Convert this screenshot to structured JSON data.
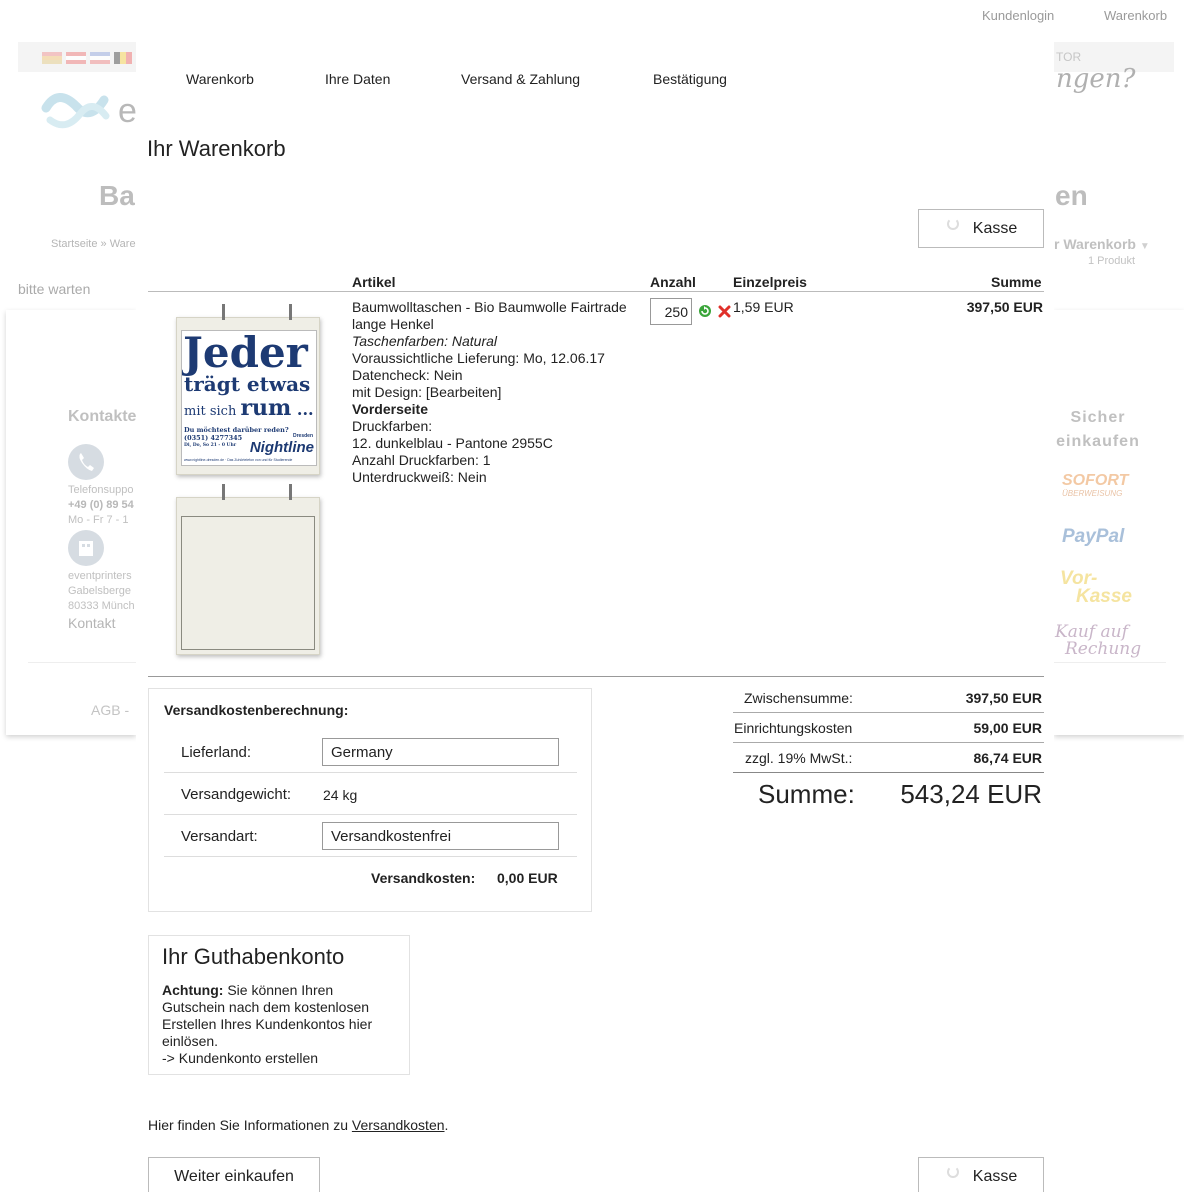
{
  "top_nav": {
    "login": "Kundenlogin",
    "cart": "Warenkorb"
  },
  "background": {
    "tagline_fragment": "ngen?",
    "tor_fragment": "TOR",
    "logo_letter": "e",
    "title_left": "Ba",
    "title_right": "en",
    "breadcrumb": "Startseite » Waren",
    "loading_text": "bitte warten",
    "mini_cart_label": "r Warenkorb",
    "mini_cart_count": "1 Produkt",
    "contact": {
      "heading": "Kontakte",
      "phone_label": "Telefonsuppo",
      "phone_number": "+49 (0) 89 54",
      "hours": "Mo - Fr   7 - 1",
      "company": "eventprinters",
      "street": "Gabelsberge",
      "city": "80333 Münch",
      "link": "Kontakt",
      "footer": "AGB -"
    },
    "secure": {
      "heading_line1": "Sicher",
      "heading_line2": "einkaufen",
      "sofort": "SOFORT",
      "sofort_sub": "ÜBERWEISUNG",
      "paypal": "PayPal",
      "vorkasse_1": "Vor-",
      "vorkasse_2": "Kasse",
      "rechnung_1": "Kauf auf",
      "rechnung_2": "Rechung"
    }
  },
  "steps": [
    "Warenkorb",
    "Ihre Daten",
    "Versand & Zahlung",
    "Bestätigung"
  ],
  "page_title": "Ihr Warenkorb",
  "checkout_label": "Kasse",
  "table": {
    "headers": {
      "article": "Artikel",
      "qty": "Anzahl",
      "unit_price": "Einzelpreis",
      "sum": "Summe"
    }
  },
  "item": {
    "name_line1": "Baumwolltaschen - Bio Baumwolle Fairtrade",
    "name_line2": "lange Henkel",
    "color": "Taschenfarben: Natural",
    "delivery": "Voraussichtliche Lieferung: Mo, 12.06.17",
    "datacheck": "Datencheck: Nein",
    "design": "mit Design: [Bearbeiten]",
    "side": "Vorderseite",
    "print_colors_label": "Druckfarben:",
    "print_color": "12. dunkelblau - Pantone 2955C",
    "print_color_count": "Anzahl Druckfarben: 1",
    "underprint": "Unterdruckweiß: Nein",
    "qty": "250",
    "unit_price": "1,59 EUR",
    "sum": "397,50 EUR",
    "bag_print": {
      "line1": "Jeder",
      "line2": "trägt etwas",
      "line3a": "mit sich ",
      "line3b": "rum",
      "line3c": " ...",
      "small1": "Du möchtest darüber reden?",
      "small2": "(0351) 4277345",
      "small3": "Di, Do, So 21 - 0 Uhr",
      "brand": "Nightline",
      "brand_tag": "Dresden",
      "url": "www.nightline-dresden.de · Das Zuhörtelefon von und für Studierende"
    }
  },
  "shipping": {
    "title": "Versandkostenberechnung:",
    "country_label": "Lieferland:",
    "country_value": "Germany",
    "weight_label": "Versandgewicht:",
    "weight_value": "24 kg",
    "method_label": "Versandart:",
    "method_value": "Versandkostenfrei",
    "cost_label": "Versandkosten:",
    "cost_value": "0,00 EUR"
  },
  "totals": {
    "subtotal_label": "Zwischensumme:",
    "subtotal_value": "397,50 EUR",
    "setup_label": "Einrichtungskosten",
    "setup_value": "59,00 EUR",
    "vat_label": "zzgl. 19% MwSt.:",
    "vat_value": "86,74 EUR",
    "total_label": "Summe:",
    "total_value": "543,24 EUR"
  },
  "credit": {
    "title": "Ihr Guthabenkonto",
    "attention": "Achtung:",
    "text_line1": " Sie können Ihren",
    "text_line2": "Gutschein nach dem kostenlosen",
    "text_line3": "Erstellen Ihres Kundenkontos hier",
    "text_line4": "einlösen.",
    "link": "-> Kundenkonto erstellen"
  },
  "info": {
    "prefix": "Hier finden Sie Informationen zu ",
    "link": "Versandkosten",
    "suffix": "."
  },
  "continue_label": "Weiter einkaufen",
  "colors": {
    "bag_text": "#1d3a73",
    "refresh": "#3aa53a",
    "remove": "#e0302a"
  }
}
